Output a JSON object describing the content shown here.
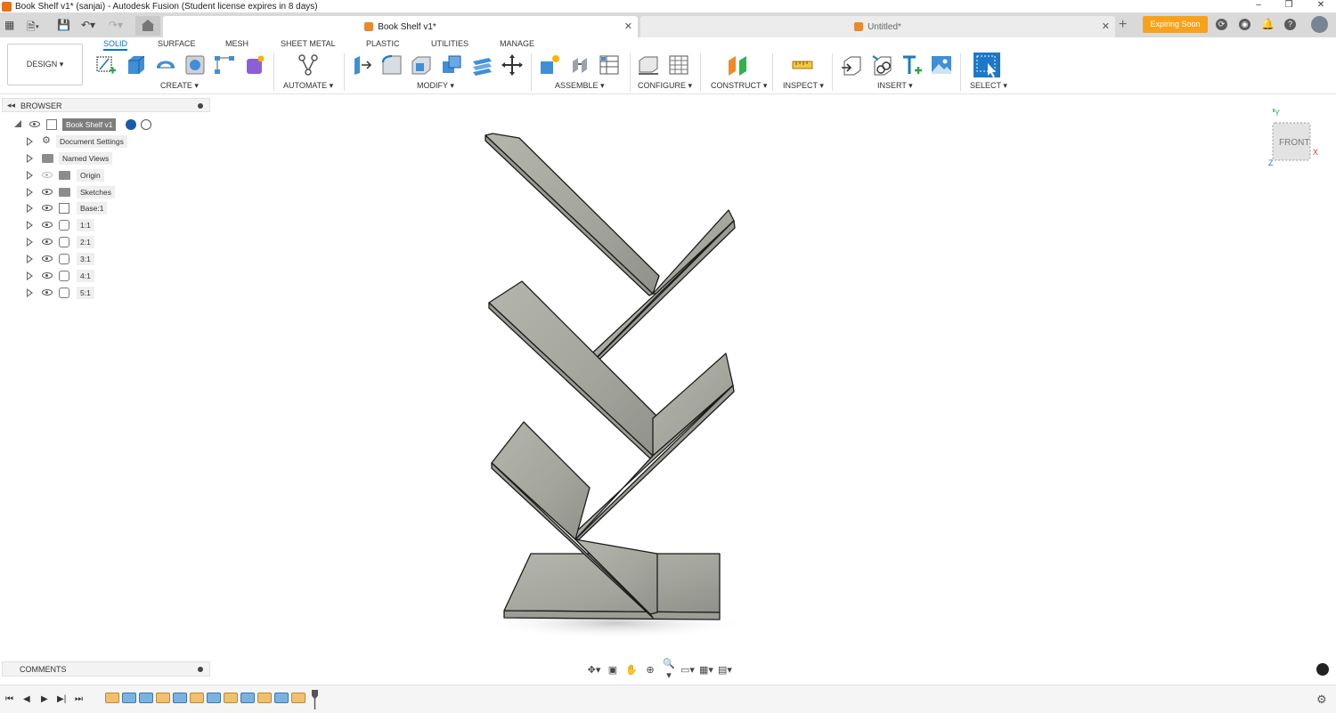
{
  "window": {
    "title": "Book Shelf v1* (sanjai) - Autodesk Fusion (Student license expires in 8 days)",
    "controls": {
      "minimize": "–",
      "maximize": "❐",
      "close": "✕"
    }
  },
  "tabs": [
    {
      "label": "Book Shelf v1*",
      "active": true,
      "close": "✕"
    },
    {
      "label": "Untitled*",
      "active": false,
      "close": "✕"
    }
  ],
  "tabbar": {
    "new_tab": "+",
    "expiring_label": "Expiring Soon",
    "expiring_color": "#F8A21A"
  },
  "ribbon": {
    "workspace": "DESIGN ▾",
    "tabs": [
      "SOLID",
      "SURFACE",
      "MESH",
      "SHEET METAL",
      "PLASTIC",
      "UTILITIES",
      "MANAGE"
    ],
    "active_tab": "SOLID",
    "groups": [
      "CREATE ▾",
      "AUTOMATE ▾",
      "MODIFY ▾",
      "ASSEMBLE ▾",
      "CONFIGURE ▾",
      "CONSTRUCT ▾",
      "INSPECT ▾",
      "INSERT ▾",
      "SELECT ▾"
    ],
    "accent": "#0B73C9"
  },
  "browser": {
    "title": "BROWSER",
    "collapse": "◂◂",
    "root": "Book Shelf v1",
    "items": [
      {
        "label": "Document Settings",
        "icon": "gear-icon"
      },
      {
        "label": "Named Views",
        "icon": "folder-icon"
      },
      {
        "label": "Origin",
        "icon": "folder-icon",
        "visible": false
      },
      {
        "label": "Sketches",
        "icon": "folder-icon"
      },
      {
        "label": "Base:1",
        "icon": "component-icon"
      },
      {
        "label": "1:1",
        "icon": "body-icon"
      },
      {
        "label": "2:1",
        "icon": "body-icon"
      },
      {
        "label": "3:1",
        "icon": "body-icon"
      },
      {
        "label": "4:1",
        "icon": "body-icon"
      },
      {
        "label": "5:1",
        "icon": "body-icon"
      }
    ]
  },
  "comments": {
    "title": "COMMENTS"
  },
  "viewcube": {
    "face": "FRONT",
    "x_axis": "X",
    "y_axis": "Y",
    "z_axis": "Z"
  },
  "viewport": {
    "model_color": "#A9ABA2",
    "edge_color": "#1B1B1B"
  },
  "timeline": {
    "controls": [
      "⏮",
      "◀",
      "▶",
      "▶|",
      "⏭"
    ],
    "items": [
      "sketch",
      "extrude",
      "extrude",
      "sketch",
      "extrude",
      "sketch",
      "extrude",
      "sketch",
      "extrude",
      "sketch",
      "extrude",
      "sketch",
      "extrude"
    ]
  }
}
